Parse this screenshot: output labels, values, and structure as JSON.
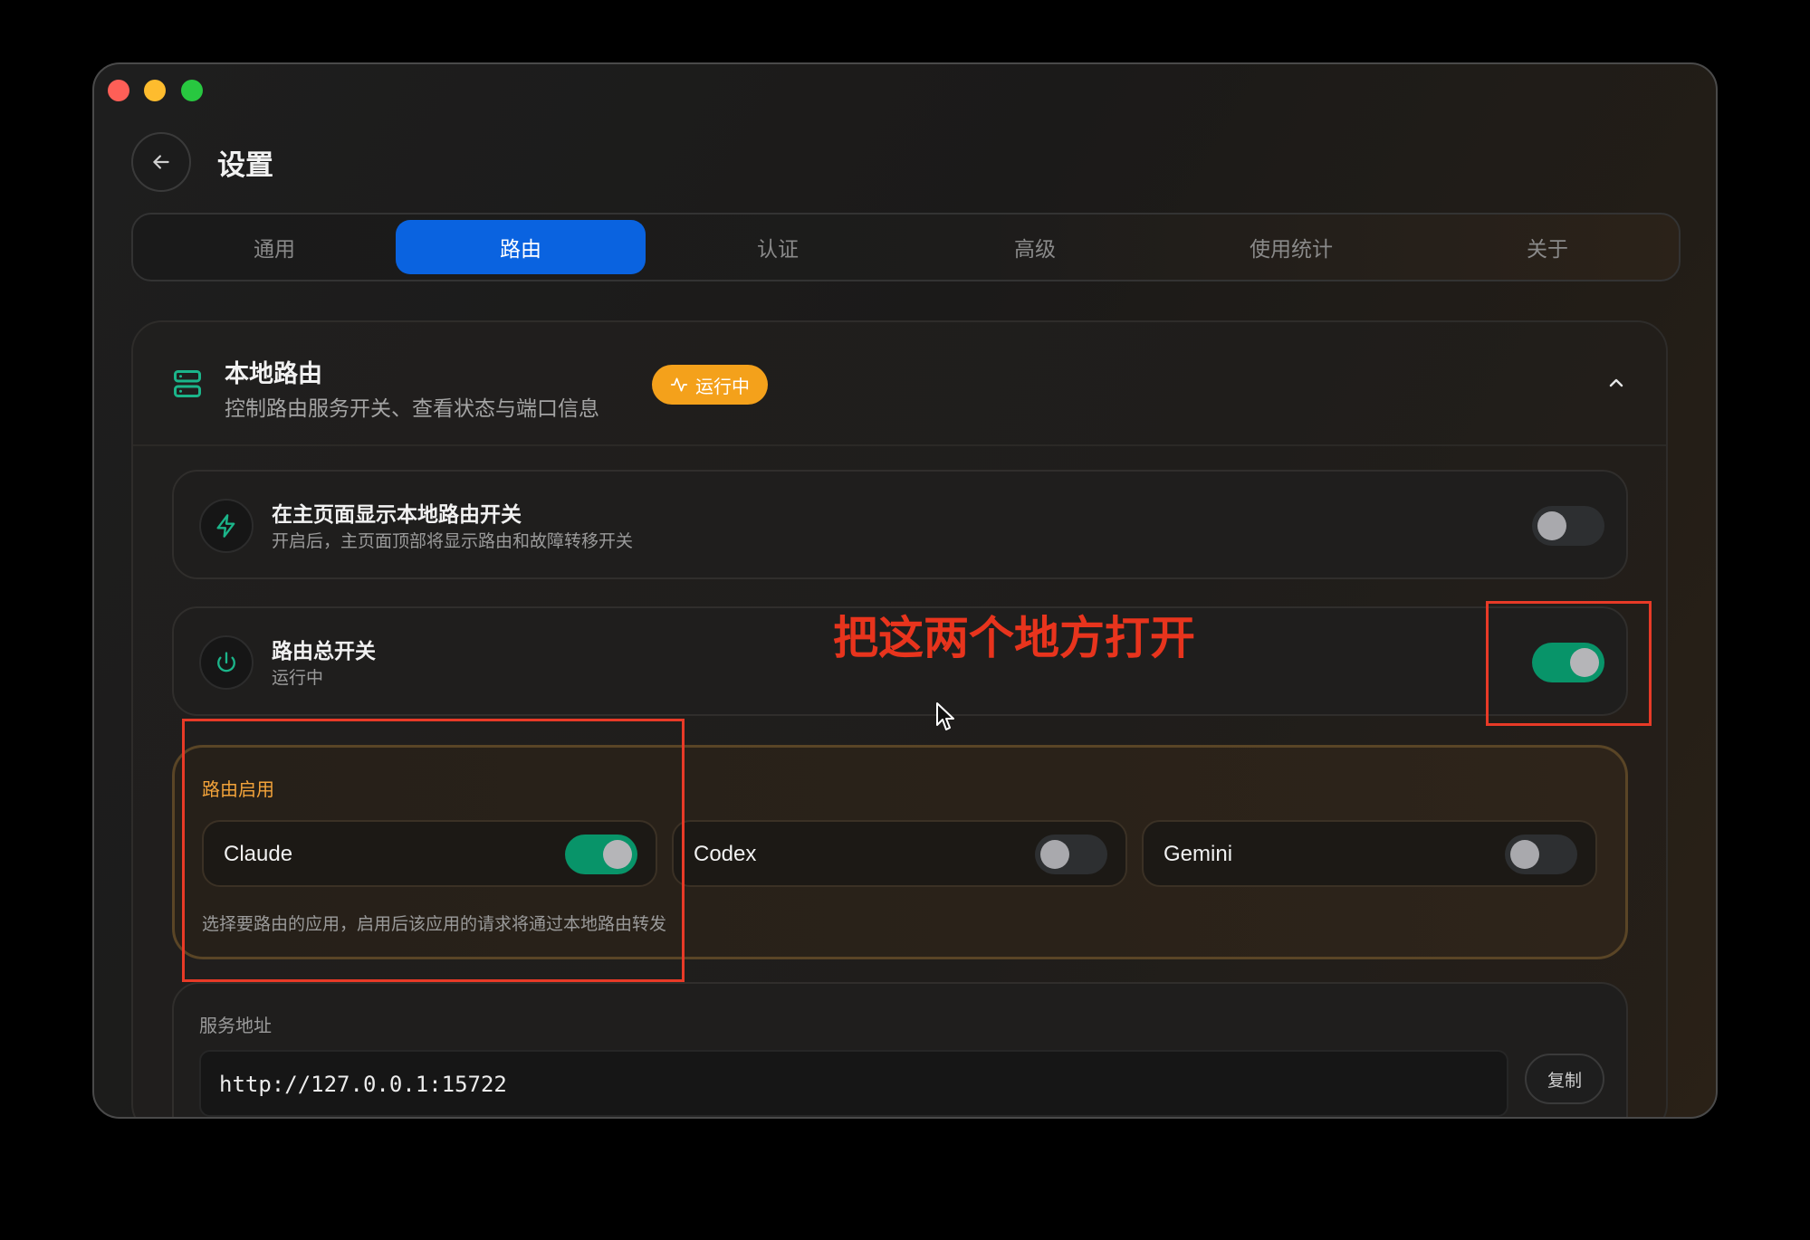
{
  "window": {
    "title": "设置"
  },
  "tabs": [
    "通用",
    "路由",
    "认证",
    "高级",
    "使用统计",
    "关于"
  ],
  "active_tab": "路由",
  "section": {
    "title": "本地路由",
    "subtitle": "控制路由服务开关、查看状态与端口信息",
    "badge": "运行中"
  },
  "rows": {
    "show_toggle": {
      "title": "在主页面显示本地路由开关",
      "subtitle": "开启后，主页面顶部将显示路由和故障转移开关",
      "enabled": false
    },
    "master": {
      "title": "路由总开关",
      "subtitle": "运行中",
      "enabled": true
    }
  },
  "routing": {
    "label": "路由启用",
    "apps": [
      {
        "name": "Claude",
        "enabled": true
      },
      {
        "name": "Codex",
        "enabled": false
      },
      {
        "name": "Gemini",
        "enabled": false
      }
    ],
    "hint": "选择要路由的应用，启用后该应用的请求将通过本地路由转发"
  },
  "service": {
    "label": "服务地址",
    "address": "http://127.0.0.1:15722",
    "copy_label": "复制"
  },
  "annotation": {
    "text": "把这两个地方打开"
  },
  "colors": {
    "accent_blue": "#0a63e0",
    "toggle_on": "#089469",
    "badge": "#f4a11b",
    "annotation": "#e8341d",
    "route_label": "#f3a33a"
  }
}
